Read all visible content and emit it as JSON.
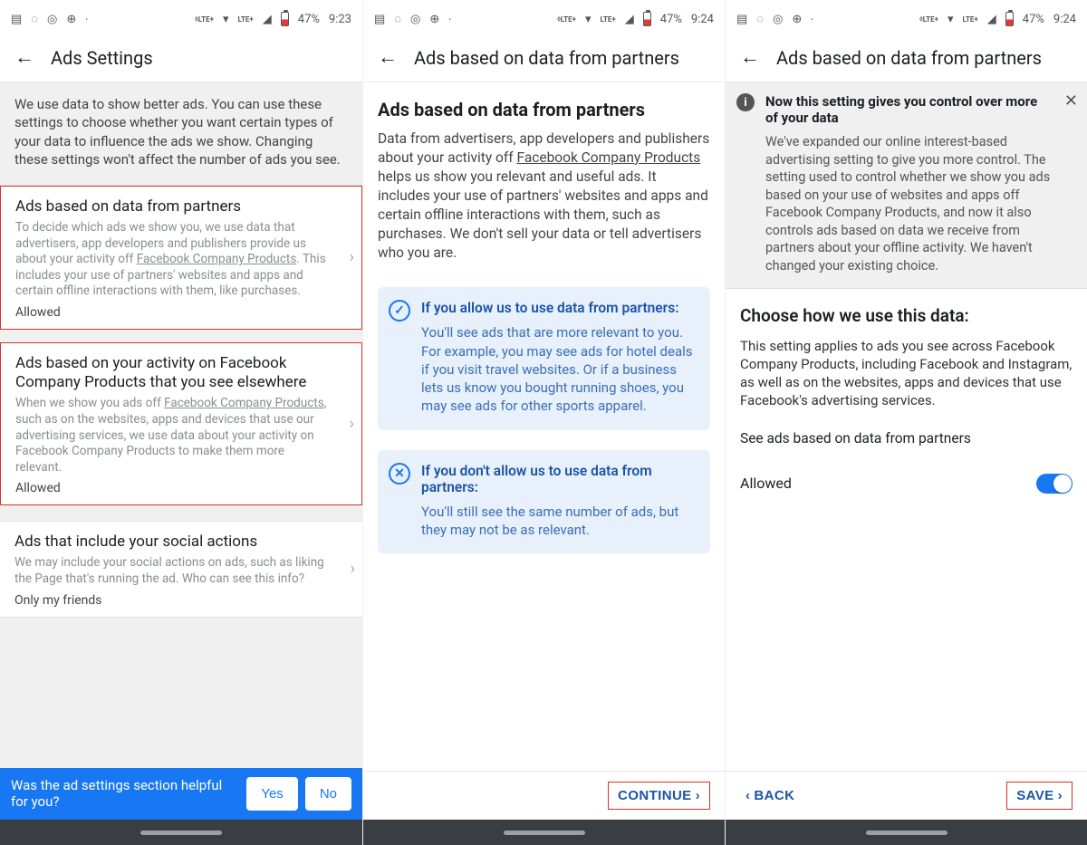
{
  "statusbar": {
    "battery": "47%",
    "time1": "9:23",
    "time2": "9:24",
    "time3": "9:24",
    "lte": "LTE+"
  },
  "panel1": {
    "title": "Ads Settings",
    "intro": "We use data to show better ads. You can use these settings to choose whether you want certain types of your data to influence the ads we show. Changing these settings won't affect the number of ads you see.",
    "item1": {
      "title": "Ads based on data from partners",
      "desc_pre": "To decide which ads we show you, we use data that advertisers, app developers and publishers provide us about your activity off ",
      "desc_link": "Facebook Company Products",
      "desc_post": ". This includes your use of partners' websites and apps and certain offline interactions with them, like purchases.",
      "status": "Allowed"
    },
    "item2": {
      "title": "Ads based on your activity on Facebook Company Products that you see elsewhere",
      "desc_pre": "When we show you ads off ",
      "desc_link": "Facebook Company Products",
      "desc_post": ", such as on the websites, apps and devices that use our advertising services, we use data about your activity on Facebook Company Products to make them more relevant.",
      "status": "Allowed"
    },
    "item3": {
      "title": "Ads that include your social actions",
      "desc": "We may include your social actions on ads, such as liking the Page that's running the ad. Who can see this info?",
      "status": "Only my friends"
    },
    "feedback": {
      "question": "Was the ad settings section helpful for you?",
      "yes": "Yes",
      "no": "No"
    }
  },
  "panel2": {
    "title": "Ads based on data from partners",
    "h1": "Ads based on data from partners",
    "para_pre": "Data from advertisers, app developers and publishers about your activity off ",
    "para_link": "Facebook Company Products",
    "para_post": " helps us show you relevant and useful ads. It includes your use of partners' websites and apps and certain offline interactions with them, such as purchases. We don't sell your data or tell advertisers who you are.",
    "card_allow": {
      "title": "If you allow us to use data from partners:",
      "body": "You'll see ads that are more relevant to you. For example, you may see ads for hotel deals if you visit travel websites. Or if a business lets us know you bought running shoes, you may see ads for other sports apparel."
    },
    "card_deny": {
      "title": "If you don't allow us to use data from partners:",
      "body": "You'll still see the same number of ads, but they may not be as relevant."
    },
    "continue": "CONTINUE"
  },
  "panel3": {
    "title": "Ads based on data from partners",
    "notice": {
      "title": "Now this setting gives you control over more of your data",
      "body": "We've expanded our online interest-based advertising setting to give you more control. The setting used to control whether we show you ads based on your use of websites and apps off Facebook Company Products, and now it also controls ads based on data we receive from partners about your offline activity. We haven't changed your existing choice."
    },
    "h2": "Choose how we use this data:",
    "para": "This setting applies to ads you see across Facebook Company Products, including Facebook and Instagram, as well as on the websites, apps and devices that use Facebook's advertising services.",
    "link": "See ads based on data from partners",
    "toggle_label": "Allowed",
    "back": "BACK",
    "save": "SAVE"
  }
}
